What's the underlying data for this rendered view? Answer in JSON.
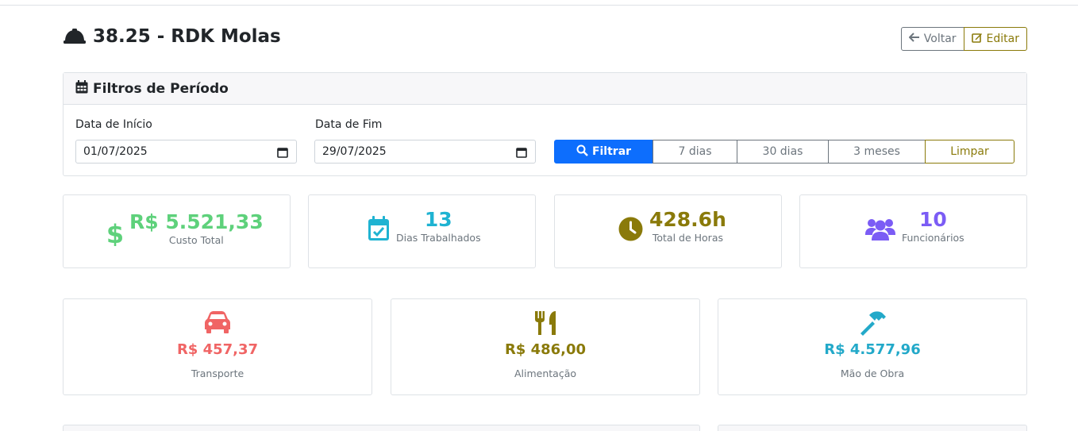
{
  "header": {
    "title": "38.25 - RDK Molas",
    "back_label": "Voltar",
    "edit_label": "Editar"
  },
  "filters": {
    "title": "Filtros de Período",
    "start_label": "Data de Início",
    "start_value": "01/07/2025",
    "end_label": "Data de Fim",
    "end_value": "29/07/2025",
    "filter_button": "Filtrar",
    "preset_7": "7 dias",
    "preset_30": "30 dias",
    "preset_3m": "3 meses",
    "clear_button": "Limpar"
  },
  "stats": [
    {
      "value": "R$ 5.521,33",
      "label": "Custo Total",
      "icon": "dollar-icon",
      "color": "#5ed17b"
    },
    {
      "value": "13",
      "label": "Dias Trabalhados",
      "icon": "calendar-check-icon",
      "color": "#1fb3d2"
    },
    {
      "value": "428.6h",
      "label": "Total de Horas",
      "icon": "clock-icon",
      "color": "#8a7a0a"
    },
    {
      "value": "10",
      "label": "Funcionários",
      "icon": "users-icon",
      "color": "#7b5cf5"
    }
  ],
  "categories": [
    {
      "value": "R$ 457,37",
      "label": "Transporte",
      "icon": "car-icon",
      "color": "#f06565"
    },
    {
      "value": "R$ 486,00",
      "label": "Alimentação",
      "icon": "utensils-icon",
      "color": "#8a7a0a"
    },
    {
      "value": "R$ 4.577,96",
      "label": "Mão de Obra",
      "icon": "hammer-icon",
      "color": "#23a9c9"
    }
  ],
  "colors": {
    "primary": "#0d6efd",
    "secondary": "#6c757d",
    "warning_outline": "#8a7a0a"
  }
}
